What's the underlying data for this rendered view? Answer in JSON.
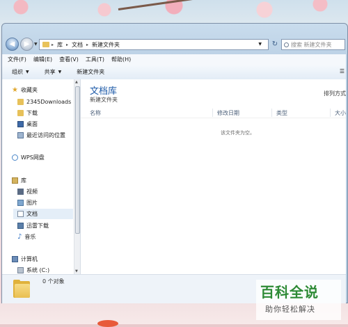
{
  "address": {
    "segments": [
      "库",
      "文档",
      "新建文件夹"
    ],
    "separator": "▸"
  },
  "search": {
    "placeholder": "搜索 新建文件夹"
  },
  "menu": [
    "文件(F)",
    "编辑(E)",
    "查看(V)",
    "工具(T)",
    "帮助(H)"
  ],
  "toolbar": {
    "organize": "组织",
    "share": "共享",
    "new_folder": "新建文件夹"
  },
  "nav": {
    "favorites": "收藏夹",
    "fav_items": [
      "2345Downloads",
      "下载",
      "桌面",
      "最近访问的位置"
    ],
    "wps": "WPS网盘",
    "libraries": "库",
    "lib_items": [
      "视频",
      "图片",
      "文档",
      "迅雷下载",
      "音乐"
    ],
    "computer": "计算机",
    "drive": "系统 (C:)"
  },
  "content": {
    "library_title": "文档库",
    "library_sub": "新建文件夹",
    "arrange_by": "排列方式",
    "columns": [
      "名称",
      "修改日期",
      "类型",
      "大小"
    ],
    "empty_msg": "该文件夹为空。"
  },
  "details": {
    "object_count": "0 个对象"
  },
  "watermark": {
    "title": "百科全说",
    "subtitle": "助你轻松解决"
  },
  "colors": {
    "library_title": "#1d5aa8",
    "watermark_green": "#2d8a35"
  }
}
